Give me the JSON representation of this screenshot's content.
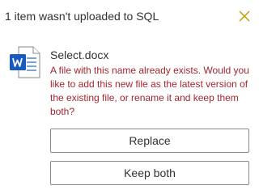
{
  "dialog": {
    "title": "1 item wasn't uploaded to SQL",
    "close_icon": "close-icon",
    "file": {
      "name": "Select.docx",
      "icon": "word-document-icon"
    },
    "message": "A file with this name already exists. Would you like to add this new file as the latest version of the existing file, or rename it and keep them both?",
    "buttons": {
      "replace_label": "Replace",
      "keep_both_label": "Keep both"
    }
  },
  "colors": {
    "error_text": "#a4262c",
    "word_blue": "#185abd",
    "close_icon": "#c19c00",
    "button_border": "#8a8886"
  }
}
